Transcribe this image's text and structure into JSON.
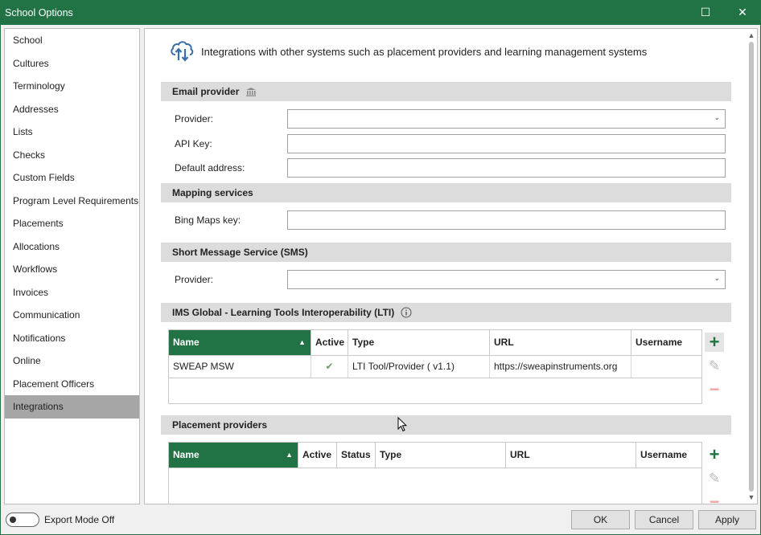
{
  "window": {
    "title": "School Options",
    "maximize_glyph": "☐",
    "close_glyph": "✕"
  },
  "sidebar": {
    "items": [
      {
        "label": "School"
      },
      {
        "label": "Cultures"
      },
      {
        "label": "Terminology"
      },
      {
        "label": "Addresses"
      },
      {
        "label": "Lists"
      },
      {
        "label": "Checks"
      },
      {
        "label": "Custom Fields"
      },
      {
        "label": "Program Level Requirements"
      },
      {
        "label": "Placements"
      },
      {
        "label": "Allocations"
      },
      {
        "label": "Workflows"
      },
      {
        "label": "Invoices"
      },
      {
        "label": "Communication"
      },
      {
        "label": "Notifications"
      },
      {
        "label": "Online"
      },
      {
        "label": "Placement Officers"
      },
      {
        "label": "Integrations"
      }
    ],
    "selected": "Integrations"
  },
  "intro": {
    "text": "Integrations with other systems such as placement providers and learning management systems"
  },
  "email_provider": {
    "title": "Email provider",
    "provider_label": "Provider:",
    "provider_value": "",
    "api_key_label": "API Key:",
    "api_key_value": "",
    "default_address_label": "Default address:",
    "default_address_value": ""
  },
  "mapping": {
    "title": "Mapping services",
    "bing_label": "Bing Maps key:",
    "bing_value": ""
  },
  "sms": {
    "title": "Short Message Service (SMS)",
    "provider_label": "Provider:",
    "provider_value": ""
  },
  "lti": {
    "title": "IMS Global - Learning Tools Interoperability (LTI)",
    "columns": [
      "Name",
      "Active",
      "Type",
      "URL",
      "Username"
    ],
    "rows": [
      {
        "name": "SWEAP MSW",
        "active": "✔",
        "type": "LTI Tool/Provider ( v1.1)",
        "url": "https://sweapinstruments.org",
        "username": ""
      }
    ]
  },
  "placement_providers": {
    "title": "Placement providers",
    "columns": [
      "Name",
      "Active",
      "Status",
      "Type",
      "URL",
      "Username"
    ],
    "rows": []
  },
  "glyphs": {
    "add": "+",
    "edit": "✎",
    "remove": "−",
    "sort_up": "▲",
    "chevron_down": "⌄",
    "scroll_up": "▲",
    "scroll_down": "▼"
  },
  "footer": {
    "export_mode_label": "Export Mode Off",
    "ok": "OK",
    "cancel": "Cancel",
    "apply": "Apply"
  },
  "colors": {
    "accent": "#217346",
    "section_bg": "#dcdcdc",
    "selected_bg": "#a6a6a6"
  }
}
